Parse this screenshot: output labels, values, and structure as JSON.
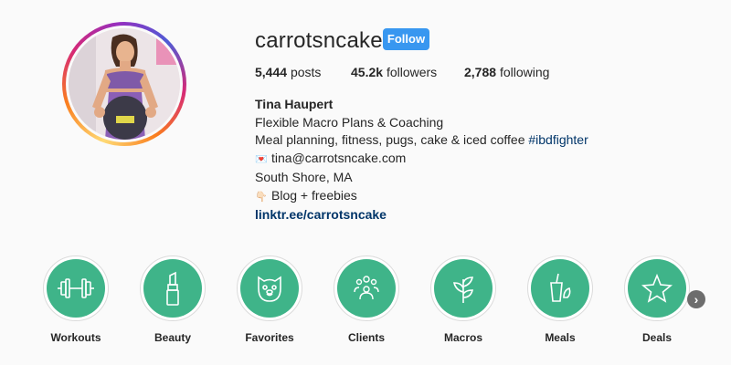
{
  "profile": {
    "username": "carrotsncake",
    "follow_label": "Follow",
    "stats": {
      "posts_count": "5,444",
      "posts_label": "posts",
      "followers_count": "45.2k",
      "followers_label": "followers",
      "following_count": "2,788",
      "following_label": "following"
    },
    "bio": {
      "name": "Tina Haupert",
      "line1": "Flexible Macro Plans & Coaching",
      "line2_text": "Meal planning, fitness, pugs, cake & iced coffee ",
      "line2_hashtag": "#ibdfighter",
      "email_icon": "💌",
      "email": "tina@carrotsncake.com",
      "location": "South Shore, MA",
      "pointer_icon": "👇🏻",
      "blog": "Blog + freebies",
      "link": "linktr.ee/carrotsncake"
    }
  },
  "highlights": [
    {
      "label": "Workouts",
      "icon": "dumbbell-icon"
    },
    {
      "label": "Beauty",
      "icon": "lipstick-icon"
    },
    {
      "label": "Favorites",
      "icon": "pug-icon"
    },
    {
      "label": "Clients",
      "icon": "group-icon"
    },
    {
      "label": "Macros",
      "icon": "leaf-icon"
    },
    {
      "label": "Meals",
      "icon": "drink-icon"
    },
    {
      "label": "Deals",
      "icon": "star-icon"
    }
  ],
  "colors": {
    "accent": "#3897f0",
    "highlight_fill": "#3fb489",
    "link": "#003569",
    "text": "#262626"
  },
  "next_icon": "chevron-right-icon"
}
